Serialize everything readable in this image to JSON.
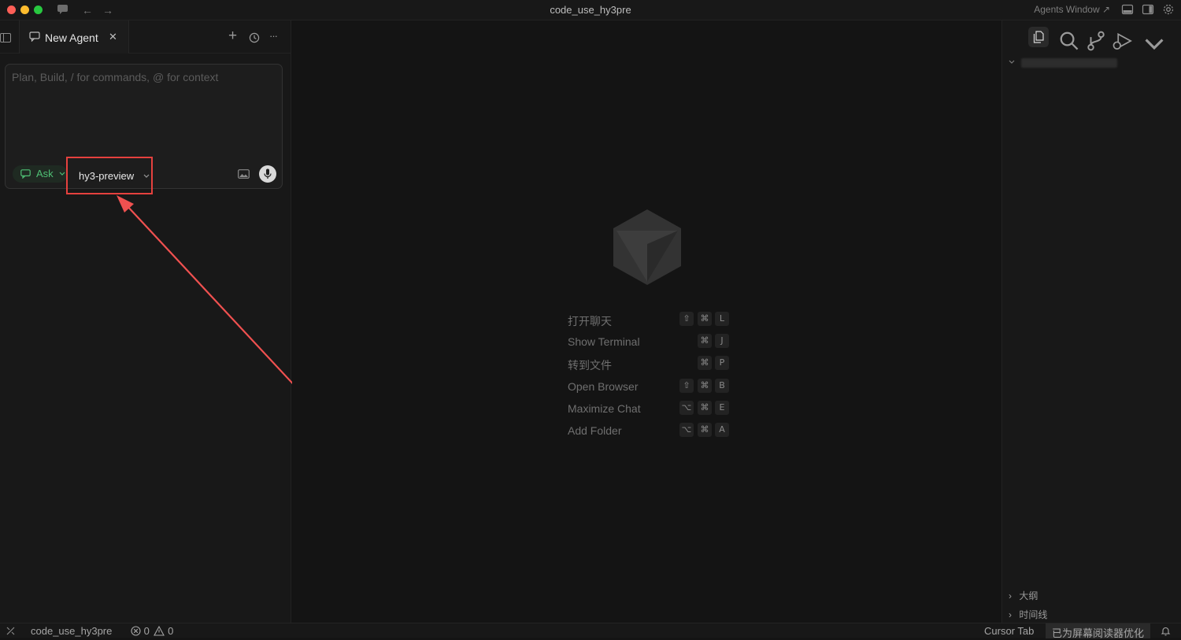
{
  "window": {
    "title": "code_use_hy3pre",
    "agents_window_label": "Agents Window ↗"
  },
  "tab": {
    "label": "New Agent",
    "close_glyph": "✕"
  },
  "tab_actions": {
    "new_glyph": "+",
    "more_glyph": "···"
  },
  "composer": {
    "placeholder": "Plan, Build, / for commands, @ for context",
    "mode_label": "Ask",
    "model_label": "hy3-preview"
  },
  "shortcuts": [
    {
      "label": "打开聊天",
      "keys": [
        "⇧",
        "⌘",
        "L"
      ]
    },
    {
      "label": "Show Terminal",
      "keys": [
        "⌘",
        "J"
      ]
    },
    {
      "label": "转到文件",
      "keys": [
        "⌘",
        "P"
      ]
    },
    {
      "label": "Open Browser",
      "keys": [
        "⇧",
        "⌘",
        "B"
      ]
    },
    {
      "label": "Maximize Chat",
      "keys": [
        "⌥",
        "⌘",
        "E"
      ]
    },
    {
      "label": "Add Folder",
      "keys": [
        "⌥",
        "⌘",
        "A"
      ]
    }
  ],
  "right_panel": {
    "sections": [
      {
        "label": "大纲"
      },
      {
        "label": "时间线"
      }
    ]
  },
  "statusbar": {
    "project": "code_use_hy3pre",
    "errors": "0",
    "warnings": "0",
    "cursor_tab": "Cursor Tab",
    "screen_reader": "已为屏幕阅读器优化"
  },
  "colors": {
    "accent_green": "#4fbf74",
    "highlight_red": "#e5413e"
  }
}
